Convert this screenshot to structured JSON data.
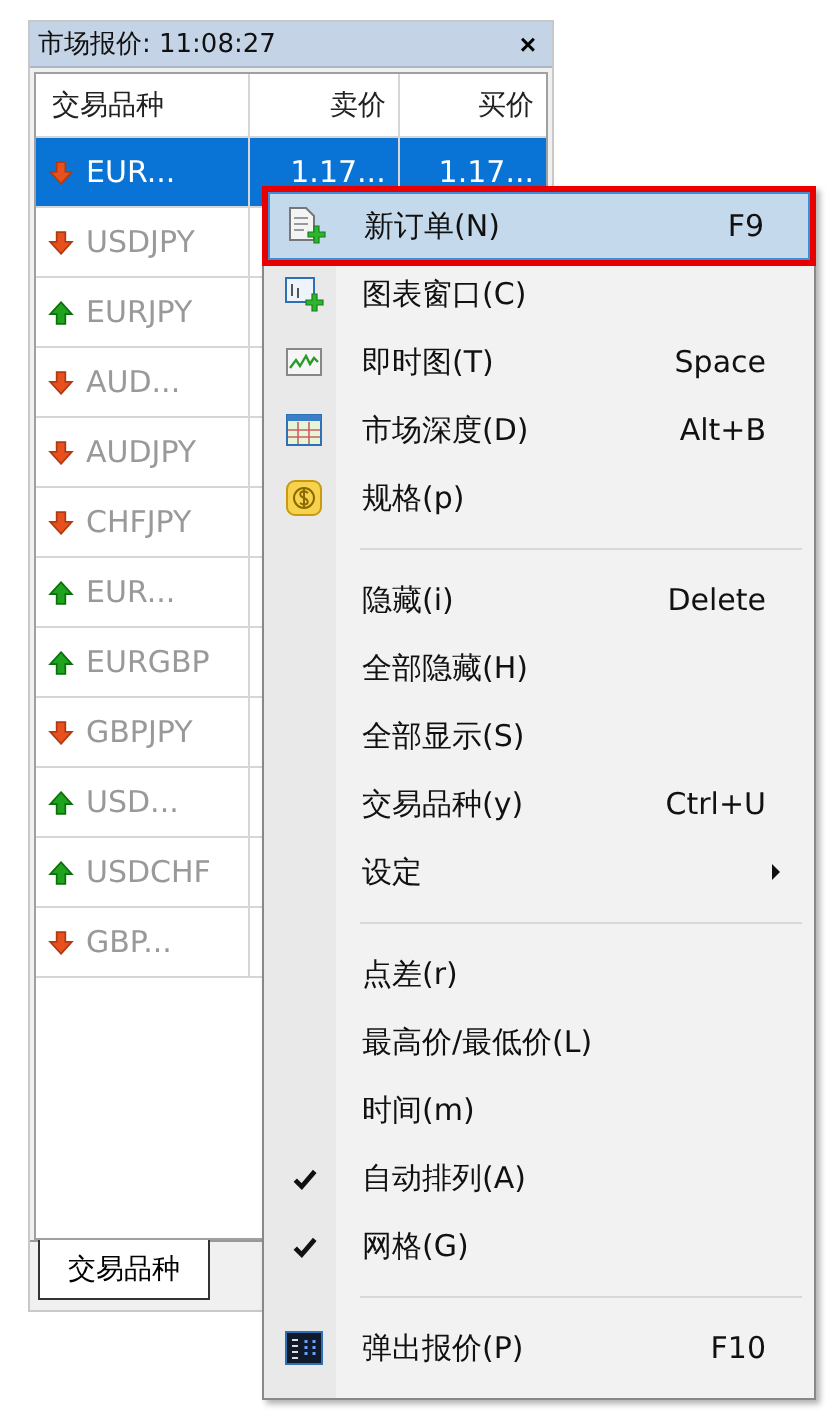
{
  "window": {
    "title": "市场报价: 11:08:27",
    "close": "×"
  },
  "table": {
    "columns": [
      "交易品种",
      "卖价",
      "买价"
    ],
    "rows": [
      {
        "symbol": "EUR...",
        "kind": "down",
        "selected": true,
        "bid": "1.17...",
        "ask": "1.17..."
      },
      {
        "symbol": "USDJPY",
        "kind": "down",
        "selected": false
      },
      {
        "symbol": "EURJPY",
        "kind": "up",
        "selected": false
      },
      {
        "symbol": "AUD...",
        "kind": "down",
        "selected": false
      },
      {
        "symbol": "AUDJPY",
        "kind": "down",
        "selected": false
      },
      {
        "symbol": "CHFJPY",
        "kind": "down",
        "selected": false
      },
      {
        "symbol": "EUR...",
        "kind": "up",
        "selected": false
      },
      {
        "symbol": "EURGBP",
        "kind": "up",
        "selected": false
      },
      {
        "symbol": "GBPJPY",
        "kind": "down",
        "selected": false
      },
      {
        "symbol": "USD...",
        "kind": "up",
        "selected": false
      },
      {
        "symbol": "USDCHF",
        "kind": "up",
        "selected": false
      },
      {
        "symbol": "GBP...",
        "kind": "down",
        "selected": false
      }
    ]
  },
  "tabs": [
    {
      "label": "交易品种",
      "selected": true
    }
  ],
  "context_menu": [
    {
      "kind": "item",
      "label": "新订单(N)",
      "shortcut": "F9",
      "selected": true,
      "checked": false
    },
    {
      "kind": "item",
      "label": "图表窗口(C)",
      "selected": false,
      "checked": false
    },
    {
      "kind": "item",
      "label": "即时图(T)",
      "shortcut": "Space",
      "selected": false,
      "checked": false
    },
    {
      "kind": "item",
      "label": "市场深度(D)",
      "shortcut": "Alt+B",
      "selected": false,
      "checked": false
    },
    {
      "kind": "item",
      "label": "规格(p)",
      "selected": false,
      "checked": false
    },
    {
      "kind": "separator"
    },
    {
      "kind": "item",
      "label": "隐藏(i)",
      "shortcut": "Delete",
      "selected": false,
      "checked": false
    },
    {
      "kind": "item",
      "label": "全部隐藏(H)",
      "selected": false,
      "checked": false
    },
    {
      "kind": "item",
      "label": "全部显示(S)",
      "selected": false,
      "checked": false
    },
    {
      "kind": "item",
      "label": "交易品种(y)",
      "shortcut": "Ctrl+U",
      "selected": false,
      "checked": false
    },
    {
      "kind": "item",
      "label": "设定",
      "submenu": true,
      "selected": false,
      "checked": false
    },
    {
      "kind": "separator"
    },
    {
      "kind": "item",
      "label": "点差(r)",
      "selected": false,
      "checked": false
    },
    {
      "kind": "item",
      "label": "最高价/最低价(L)",
      "selected": false,
      "checked": false
    },
    {
      "kind": "item",
      "label": "时间(m)",
      "selected": false,
      "checked": false
    },
    {
      "kind": "item",
      "label": "自动排列(A)",
      "selected": false,
      "checked": true
    },
    {
      "kind": "item",
      "label": "网格(G)",
      "selected": false,
      "checked": true
    },
    {
      "kind": "separator"
    },
    {
      "kind": "item",
      "label": "弹出报价(P)",
      "shortcut": "F10",
      "selected": false,
      "checked": false
    }
  ]
}
